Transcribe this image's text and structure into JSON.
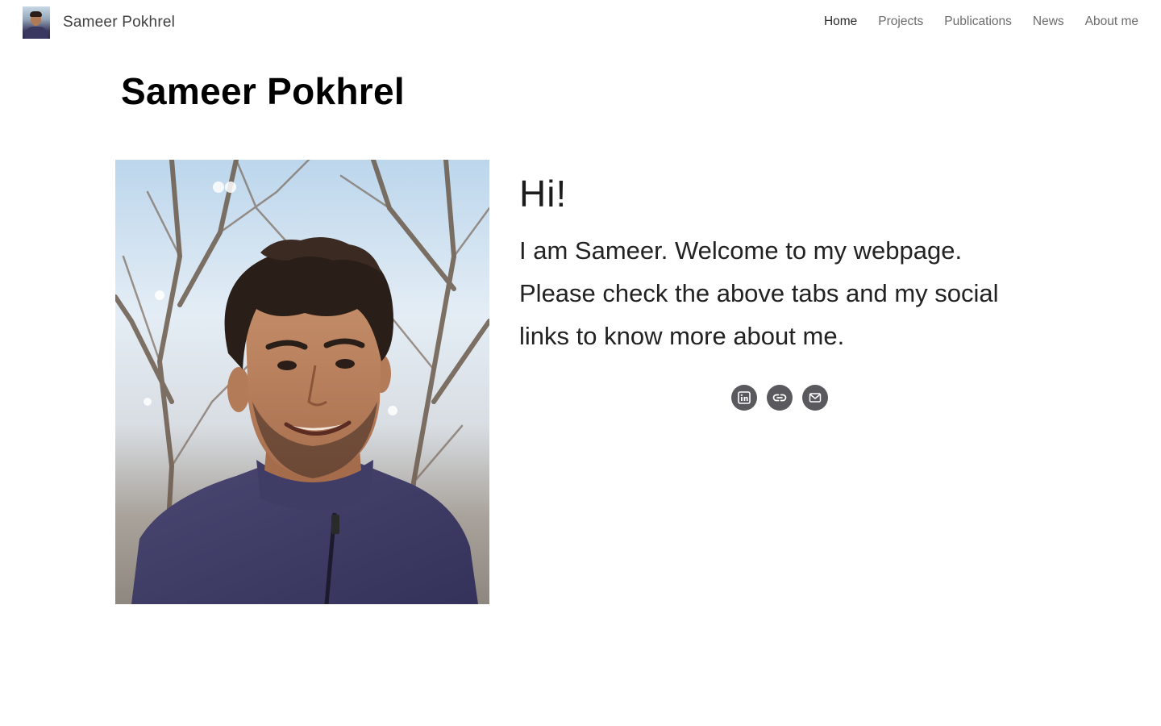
{
  "nav": {
    "brand_name": "Sameer Pokhrel",
    "links": [
      {
        "label": "Home",
        "active": true
      },
      {
        "label": "Projects",
        "active": false
      },
      {
        "label": "Publications",
        "active": false
      },
      {
        "label": "News",
        "active": false
      },
      {
        "label": "About me",
        "active": false
      }
    ]
  },
  "page": {
    "title": "Sameer Pokhrel"
  },
  "intro": {
    "greeting": "Hi!",
    "bio": "I am Sameer. Welcome to my webpage. Please check the above tabs and my social links to know more about me."
  },
  "social": [
    {
      "icon": "linkedin-icon"
    },
    {
      "icon": "link-icon"
    },
    {
      "icon": "email-icon"
    }
  ],
  "colors": {
    "social_button_bg": "#5a5a5e",
    "nav_active": "#2b2b2b",
    "nav_inactive": "#6c6c6c",
    "title": "#000000"
  }
}
